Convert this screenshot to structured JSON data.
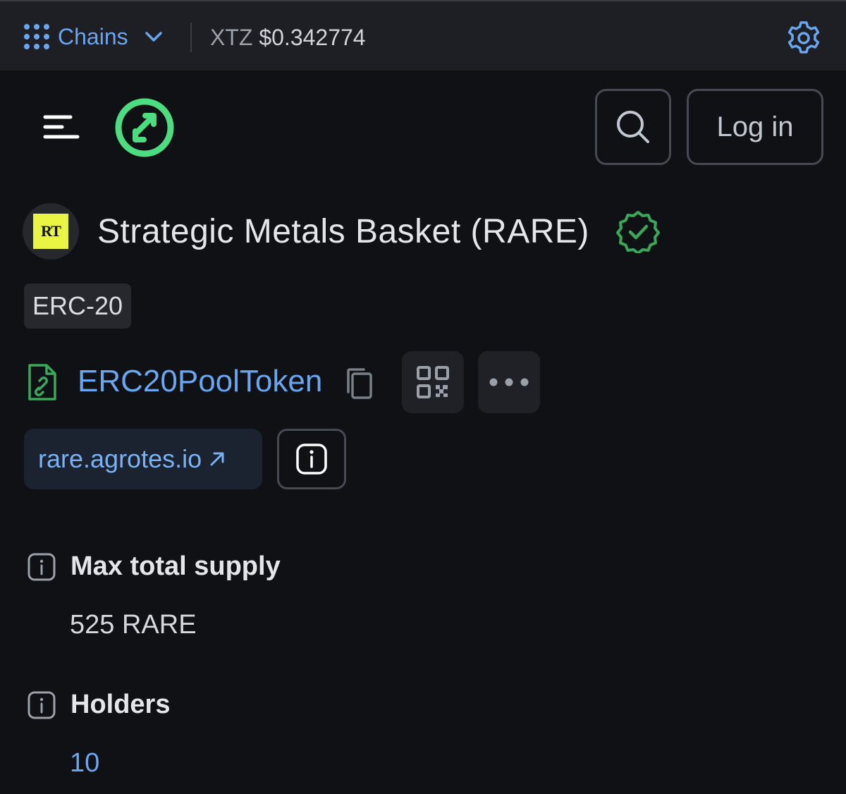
{
  "topbar": {
    "chains_label": "Chains",
    "price_symbol": "XTZ",
    "price_value": "$0.342774"
  },
  "header": {
    "login_label": "Log in"
  },
  "token": {
    "avatar_text": "RT",
    "title": "Strategic Metals Basket (RARE)",
    "standard": "ERC-20"
  },
  "contract": {
    "name": "ERC20PoolToken"
  },
  "website": {
    "label": "rare.agrotes.io"
  },
  "stats": [
    {
      "label": "Max total supply",
      "value": "525 RARE"
    },
    {
      "label": "Holders",
      "value": "10"
    }
  ],
  "colors": {
    "background": "#101114",
    "topbar": "#1d1f24",
    "accent_blue": "#6aa6f0",
    "brand_green": "#4ade80",
    "verified_green": "#3aa75b",
    "token_yellow": "#e9f542"
  },
  "icons": {
    "grid": "dots-grid-icon",
    "chevron": "chevron-down-icon",
    "settings": "gear-icon",
    "menu": "hamburger-icon",
    "logo": "brand-logo-icon",
    "search": "search-icon",
    "verified": "verified-badge-icon",
    "contract": "contract-file-icon",
    "copy": "copy-icon",
    "qr": "qr-code-icon",
    "more": "more-dots-icon",
    "external": "external-link-icon",
    "info": "info-icon"
  }
}
